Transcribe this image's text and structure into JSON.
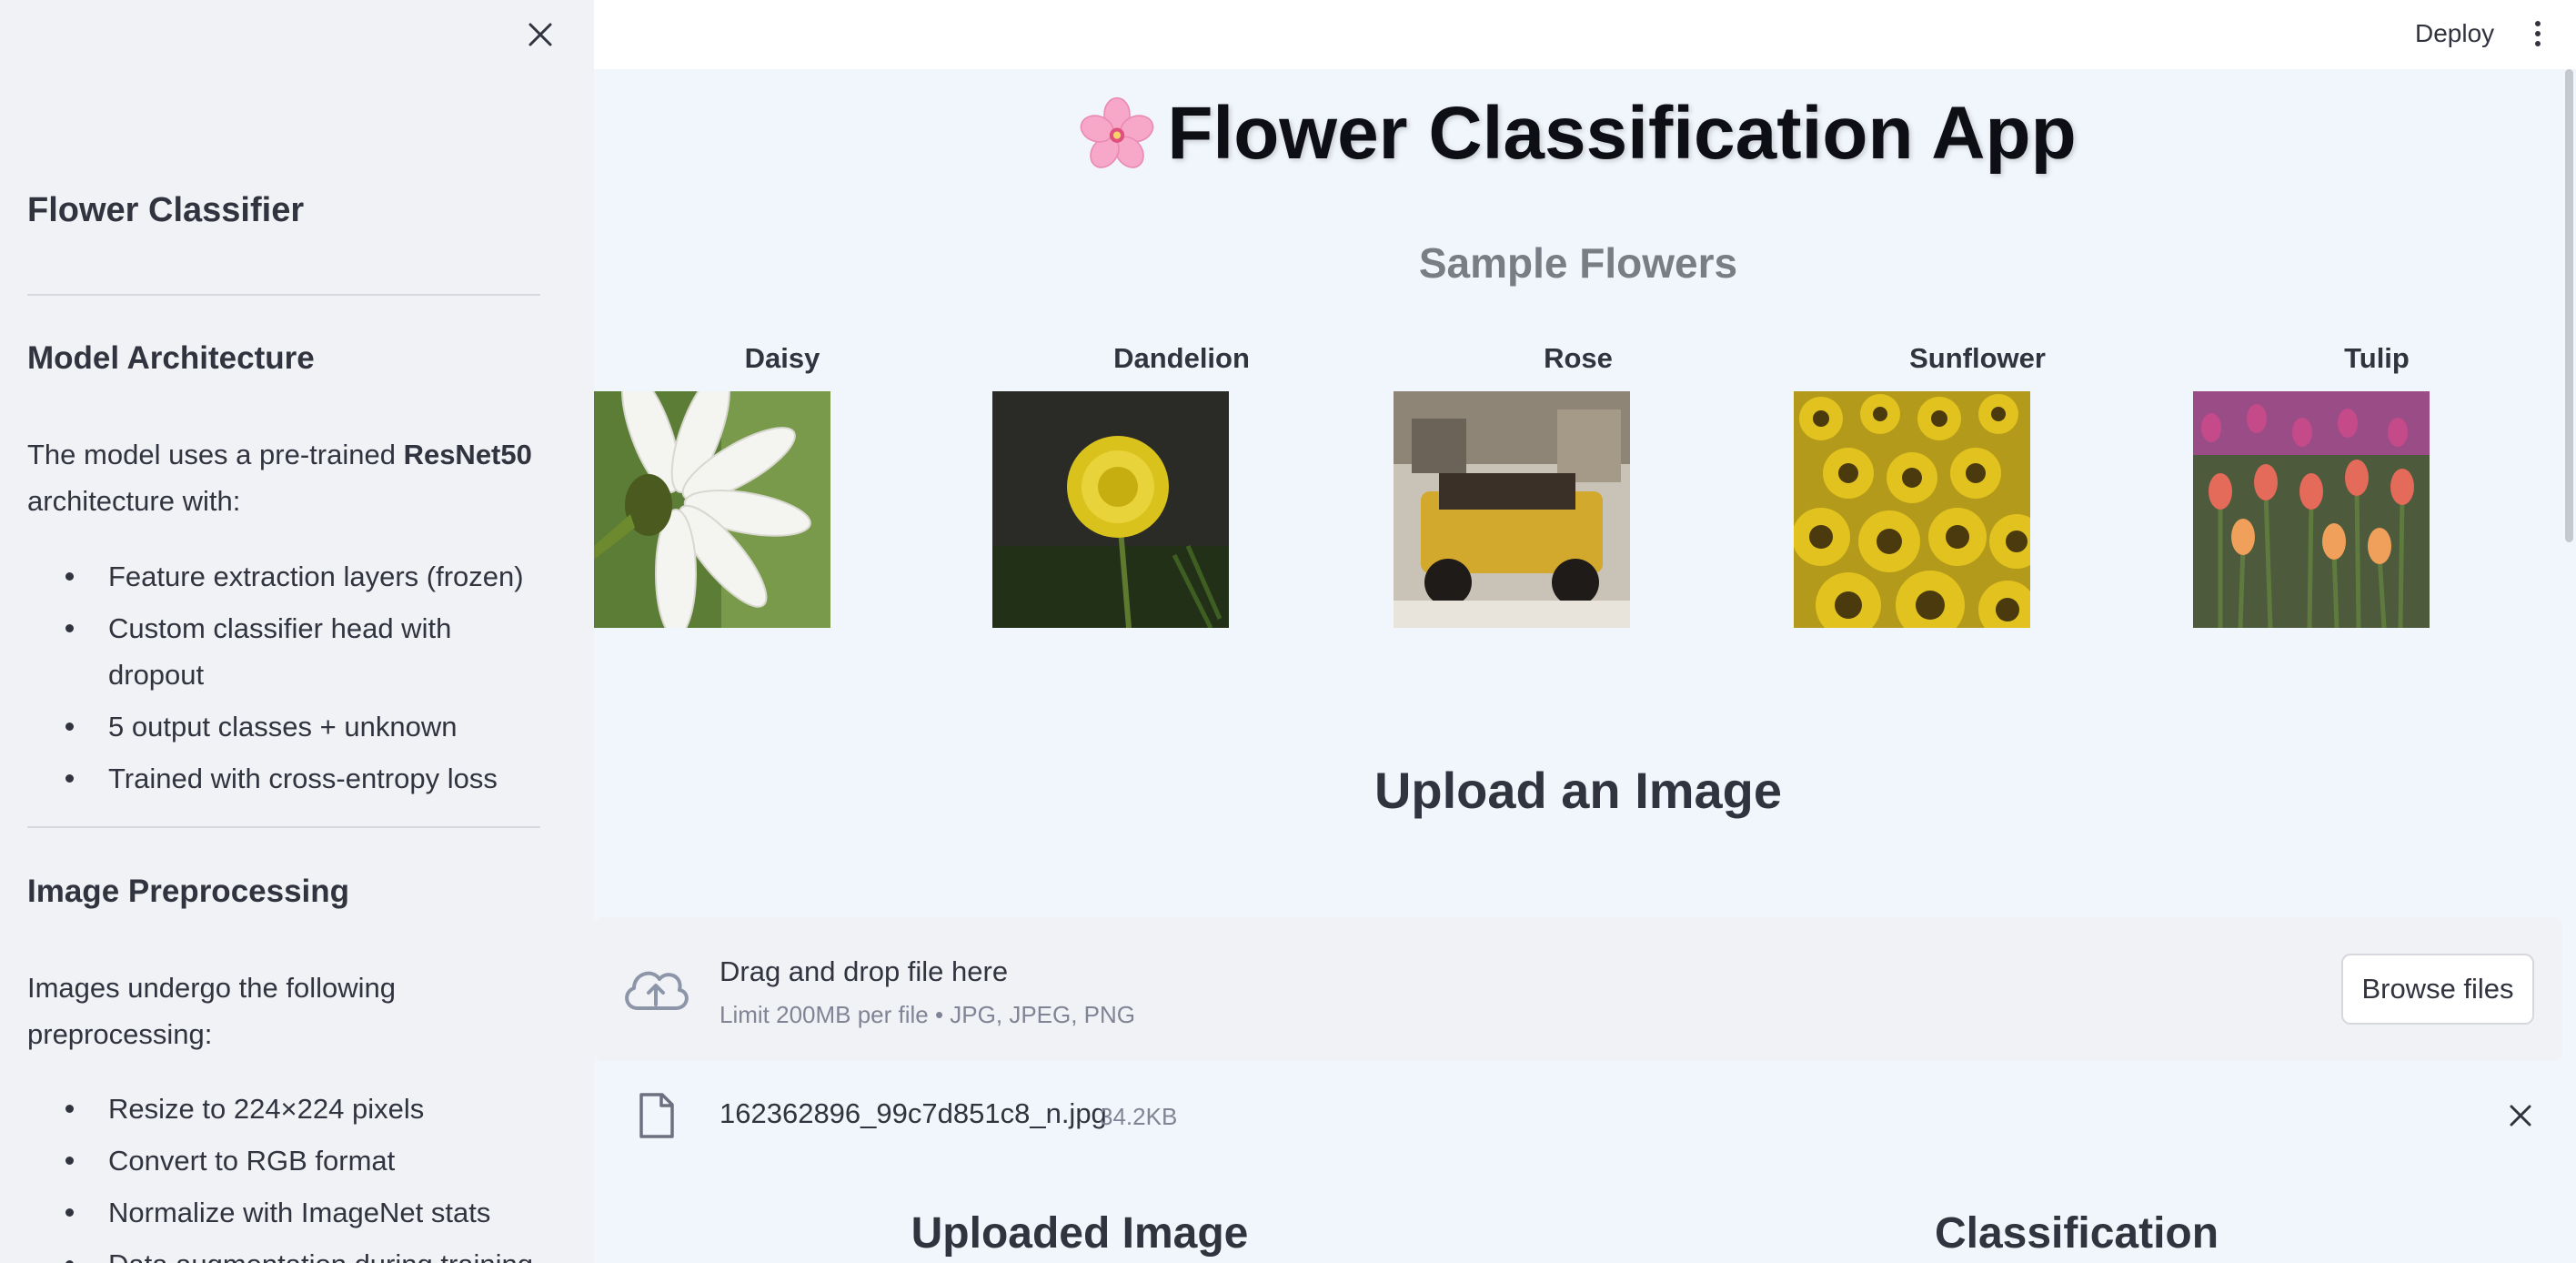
{
  "sidebar": {
    "title": "Flower Classifier",
    "model_heading": "Model Architecture",
    "model_text_prefix": "The model uses a pre-trained ",
    "model_text_bold": "ResNet50",
    "model_text_suffix": " architecture with:",
    "model_items": [
      "Feature extraction layers (frozen)",
      "Custom classifier head with dropout",
      "5 output classes + unknown",
      "Trained with cross-entropy loss"
    ],
    "preproc_heading": "Image Preprocessing",
    "preproc_text": "Images undergo the following preprocessing:",
    "preproc_items": [
      "Resize to 224×224 pixels",
      "Convert to RGB format",
      "Normalize with ImageNet stats",
      "Data augmentation during training"
    ]
  },
  "header": {
    "deploy_label": "Deploy"
  },
  "main": {
    "app_title": "Flower Classification App",
    "samples_title": "Sample Flowers",
    "samples": [
      {
        "label": "Daisy"
      },
      {
        "label": "Dandelion"
      },
      {
        "label": "Rose"
      },
      {
        "label": "Sunflower"
      },
      {
        "label": "Tulip"
      }
    ],
    "upload_title": "Upload an Image",
    "dropzone": {
      "main_text": "Drag and drop file here",
      "sub_text": "Limit 200MB per file • JPG, JPEG, PNG",
      "browse_label": "Browse files"
    },
    "file": {
      "name": "162362896_99c7d851c8_n.jpg",
      "size": "34.2KB"
    },
    "uploaded_image_title": "Uploaded Image",
    "classification_title": "Classification"
  },
  "colors": {
    "sidebar_bg": "#f0f2f6",
    "main_bg": "#f0f6fb",
    "text": "#31333f",
    "muted": "#808495"
  }
}
